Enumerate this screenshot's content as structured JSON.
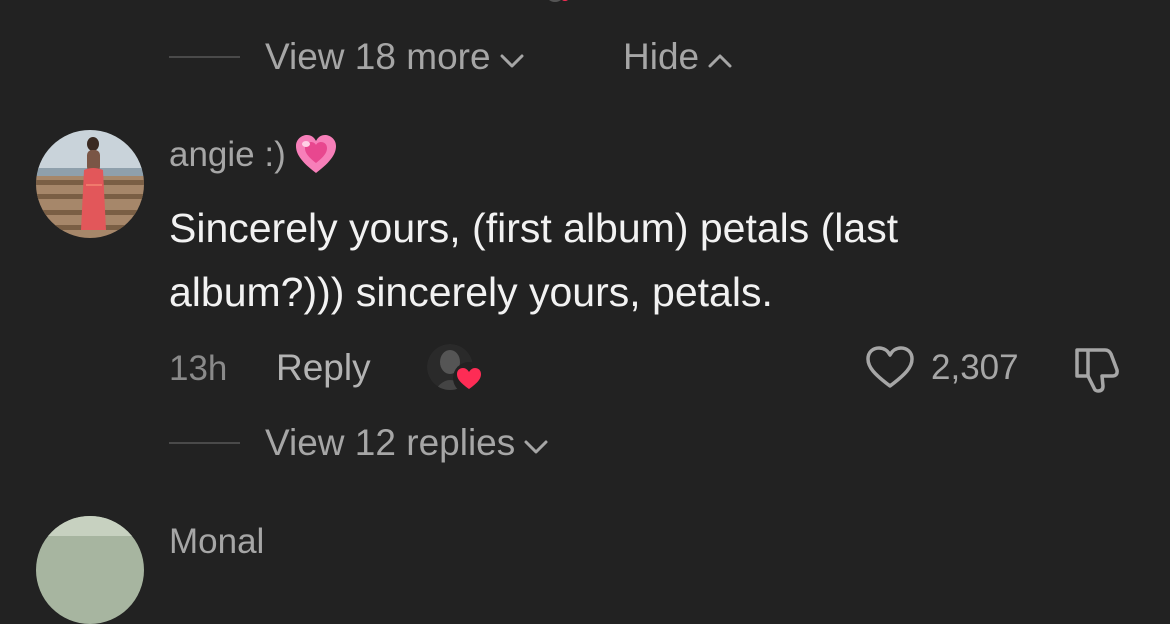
{
  "top_thread": {
    "view_more_label": "View 18 more",
    "hide_label": "Hide"
  },
  "comment": {
    "username": "angie :)",
    "username_emoji": "💗",
    "text_line1": "Sincerely yours, (first album) petals (last",
    "text_line2": "album?))) sincerely yours, petals.",
    "time": "13h",
    "reply_label": "Reply",
    "like_count": "2,307",
    "view_replies_label": "View 12 replies"
  },
  "next_comment": {
    "username": "Monal"
  },
  "colors": {
    "background": "#222222",
    "primary_text": "#f2f2f2",
    "secondary_text": "#a6a6a6",
    "heart_badge": "#fe2c55"
  },
  "icons": {
    "chevron_down": "chevron-down-icon",
    "chevron_up": "chevron-up-icon",
    "like": "heart-outline-icon",
    "dislike": "thumbs-down-icon",
    "creator_like": "creator-liked-badge"
  }
}
